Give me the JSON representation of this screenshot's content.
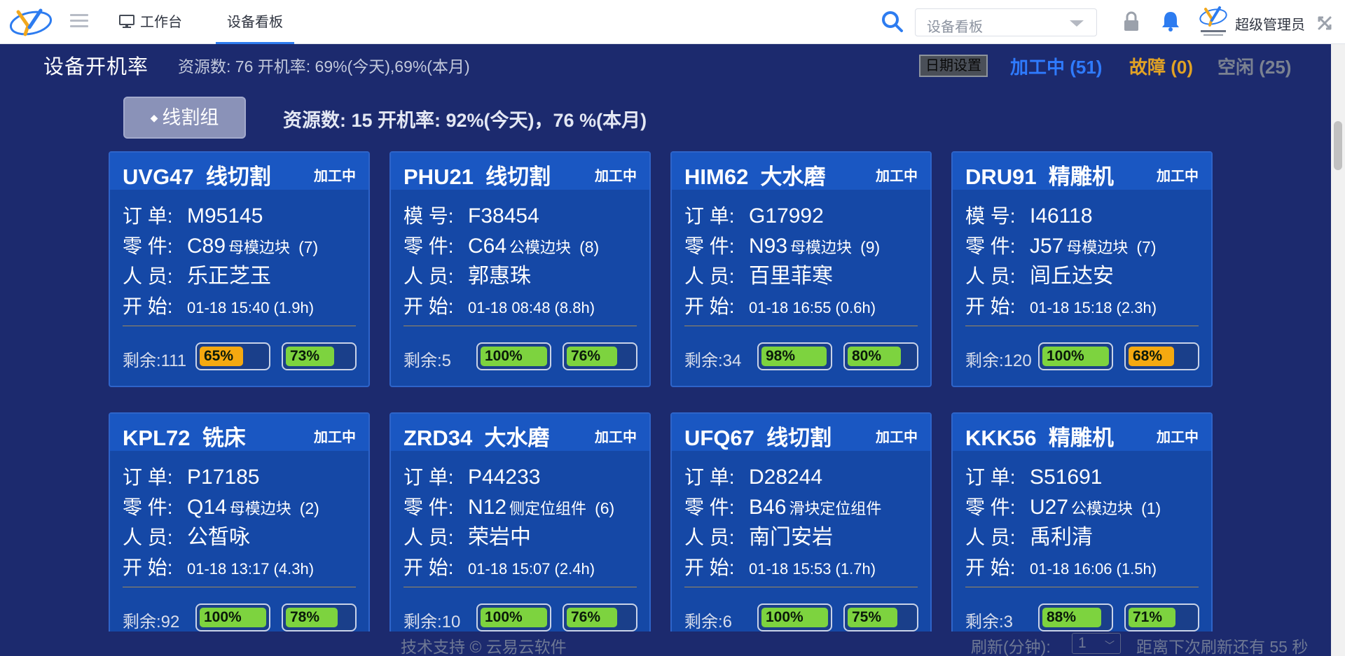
{
  "header": {
    "workbench_label": "工作台",
    "board_label": "设备看板",
    "search_select_value": "设备看板",
    "username": "超级管理员",
    "icons": [
      "logo-icon",
      "menu-icon",
      "monitor-icon",
      "search-icon",
      "lock-icon",
      "bell-icon",
      "avatar",
      "close-icon"
    ]
  },
  "summary": {
    "title": "设备开机率",
    "text": "资源数:  76   开机率: 69%(今天),69%(本月)",
    "date_button": "日期设置",
    "processing": "加工中 (51)",
    "fault": "故障 (0)",
    "idle": "空闲 (25)"
  },
  "group": {
    "name": "线割组",
    "summary": "资源数: 15  开机率: 92%(今天)，76 %(本月)"
  },
  "labels": {
    "part": "零 件:",
    "person": "人 员:",
    "start": "开 始:"
  },
  "colors": {
    "bar_green": "#7dd33f",
    "bar_orange": "#f5a910",
    "processing": "#2f7bff",
    "fault": "#e1a224",
    "idle": "#7b8291"
  },
  "cards": [
    {
      "code": "UVG47",
      "type": "线切割",
      "status": "加工中",
      "id_label": "订 单:",
      "id_value": "M95145",
      "part": "C89",
      "part_name": "母模边块",
      "qty": "(7)",
      "person": "乐正芝玉",
      "start": "01-18 15:40 (1.9h)",
      "remain": "剩余:111",
      "bars": [
        {
          "pct": 65,
          "label": "65%",
          "color": "o"
        },
        {
          "pct": 73,
          "label": "73%",
          "color": "g"
        }
      ]
    },
    {
      "code": "PHU21",
      "type": "线切割",
      "status": "加工中",
      "id_label": "模 号:",
      "id_value": "F38454",
      "part": "C64",
      "part_name": "公模边块",
      "qty": "(8)",
      "person": "郭惠珠",
      "start": "01-18 08:48 (8.8h)",
      "remain": "剩余:5",
      "bars": [
        {
          "pct": 100,
          "label": "100%",
          "color": "g"
        },
        {
          "pct": 76,
          "label": "76%",
          "color": "g"
        }
      ]
    },
    {
      "code": "HIM62",
      "type": "大水磨",
      "status": "加工中",
      "id_label": "订 单:",
      "id_value": "G17992",
      "part": "N93",
      "part_name": "母模边块",
      "qty": "(9)",
      "person": "百里菲寒",
      "start": "01-18 16:55 (0.6h)",
      "remain": "剩余:34",
      "bars": [
        {
          "pct": 98,
          "label": "98%",
          "color": "g"
        },
        {
          "pct": 80,
          "label": "80%",
          "color": "g"
        }
      ]
    },
    {
      "code": "DRU91",
      "type": "精雕机",
      "status": "加工中",
      "id_label": "模 号:",
      "id_value": "I46118",
      "part": "J57",
      "part_name": "母模边块",
      "qty": "(7)",
      "person": "闾丘达安",
      "start": "01-18 15:18 (2.3h)",
      "remain": "剩余:120",
      "bars": [
        {
          "pct": 100,
          "label": "100%",
          "color": "g"
        },
        {
          "pct": 68,
          "label": "68%",
          "color": "o"
        }
      ]
    },
    {
      "code": "KPL72",
      "type": "铣床",
      "status": "加工中",
      "id_label": "订 单:",
      "id_value": "P17185",
      "part": "Q14",
      "part_name": "母模边块",
      "qty": "(2)",
      "person": "公皙咏",
      "start": "01-18 13:17 (4.3h)",
      "remain": "剩余:92",
      "bars": [
        {
          "pct": 100,
          "label": "100%",
          "color": "g"
        },
        {
          "pct": 78,
          "label": "78%",
          "color": "g"
        }
      ]
    },
    {
      "code": "ZRD34",
      "type": "大水磨",
      "status": "加工中",
      "id_label": "订 单:",
      "id_value": "P44233",
      "part": "N12",
      "part_name": "侧定位组件",
      "qty": "(6)",
      "person": "荣岩中",
      "start": "01-18 15:07 (2.4h)",
      "remain": "剩余:10",
      "bars": [
        {
          "pct": 100,
          "label": "100%",
          "color": "g"
        },
        {
          "pct": 76,
          "label": "76%",
          "color": "g"
        }
      ]
    },
    {
      "code": "UFQ67",
      "type": "线切割",
      "status": "加工中",
      "id_label": "订 单:",
      "id_value": "D28244",
      "part": "B46",
      "part_name": "滑块定位组件",
      "qty": "",
      "person": "南门安岩",
      "start": "01-18 15:53 (1.7h)",
      "remain": "剩余:6",
      "bars": [
        {
          "pct": 100,
          "label": "100%",
          "color": "g"
        },
        {
          "pct": 75,
          "label": "75%",
          "color": "g"
        }
      ]
    },
    {
      "code": "KKK56",
      "type": "精雕机",
      "status": "加工中",
      "id_label": "订 单:",
      "id_value": "S51691",
      "part": "U27",
      "part_name": "公模边块",
      "qty": "(1)",
      "person": "禹利清",
      "start": "01-18 16:06 (1.5h)",
      "remain": "剩余:3",
      "bars": [
        {
          "pct": 88,
          "label": "88%",
          "color": "g"
        },
        {
          "pct": 71,
          "label": "71%",
          "color": "g"
        }
      ]
    }
  ],
  "footer": {
    "support": "技术支持 © 云易云软件",
    "refresh_label": "刷新(分钟):",
    "refresh_value": "1",
    "countdown": "距离下次刷新还有 55 秒"
  }
}
